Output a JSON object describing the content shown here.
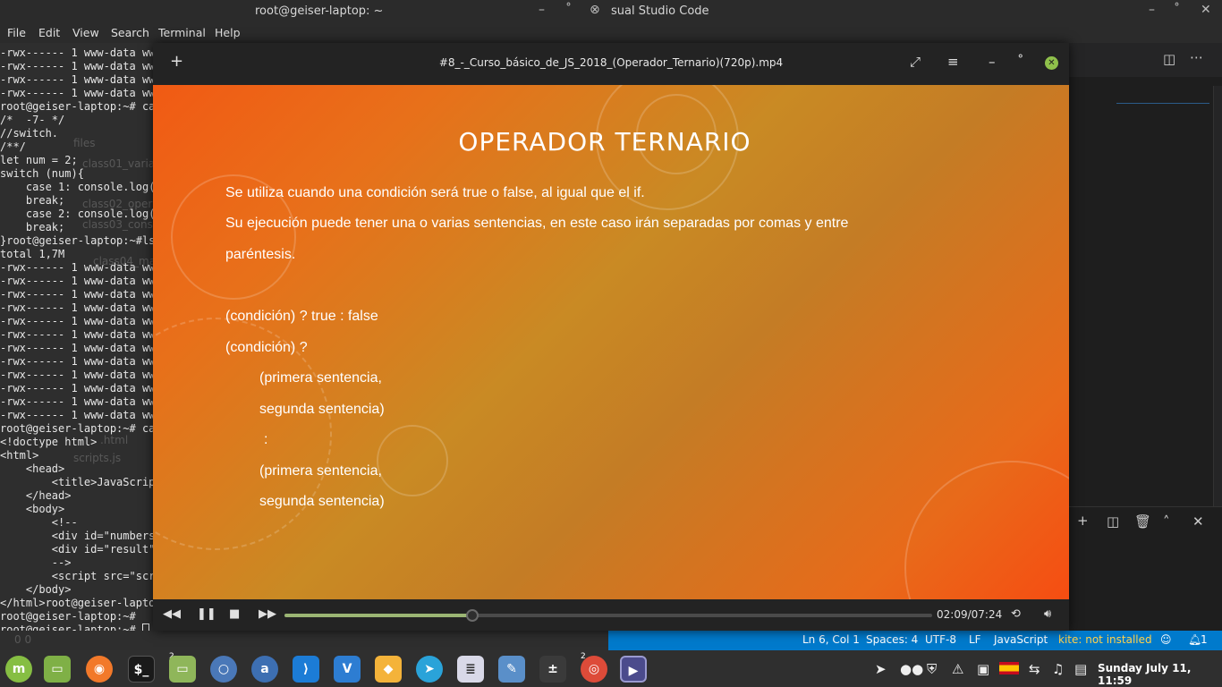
{
  "top_bar": {
    "terminal_title": "root@geiser-laptop: ~",
    "vscode_title": "sual Studio Code"
  },
  "terminal_menu": [
    "File",
    "Edit",
    "View",
    "Search",
    "Terminal",
    "Help"
  ],
  "terminal_lines": [
    "-rwx------ 1 www-data ww",
    "-rwx------ 1 www-data ww",
    "-rwx------ 1 www-data ww",
    "-rwx------ 1 www-data ww",
    "root@geiser-laptop:~# ca",
    "/*  -7- */",
    "//switch.",
    "/**/",
    "let num = 2;",
    "switch (num){",
    "    case 1: console.log(",
    "    break;",
    "    case 2: console.log(",
    "    break;",
    "}root@geiser-laptop:~#ls",
    "total 1,7M",
    "-rwx------ 1 www-data ww",
    "-rwx------ 1 www-data ww",
    "-rwx------ 1 www-data ww",
    "-rwx------ 1 www-data ww",
    "-rwx------ 1 www-data ww",
    "-rwx------ 1 www-data ww",
    "-rwx------ 1 www-data ww",
    "-rwx------ 1 www-data ww",
    "-rwx------ 1 www-data ww",
    "-rwx------ 1 www-data ww",
    "-rwx------ 1 www-data ww",
    "-rwx------ 1 www-data ww",
    "root@geiser-laptop:~# ca",
    "<!doctype html>",
    "<html>",
    "    <head>",
    "        <title>JavaScrip",
    "    </head>",
    "    <body>",
    "        <!--",
    "        <div id=\"numbers",
    "        <div id=\"result\"",
    "        -->",
    "        <script src=\"scr",
    "    </body>",
    "</html>root@geiser-lapto",
    "root@geiser-laptop:~#",
    "root@geiser-laptop:~# "
  ],
  "ghost_sidebar": {
    "files": "files",
    "class01": "class01_varia",
    "class02": "class02_oper",
    "class03": "class03_cons",
    "class04": "class04_math",
    "html": ".html",
    "scripts": "scripts.js",
    "counts": "0  0"
  },
  "player": {
    "title": "#8_-_Curso_básico_de_JS_2018_(Operador_Ternario)(720p).mp4",
    "time": "02:09/07:24",
    "progress": 0.29
  },
  "slide": {
    "title": "OPERADOR TERNARIO",
    "line1": "Se utiliza cuando una condición será true o false, al igual que el if.",
    "line2": "Su ejecución puede tener una o varias sentencias, en este caso irán separadas por comas y entre",
    "line3": "paréntesis.",
    "line4": "(condición) ? true : false",
    "line5": "(condición) ?",
    "line6": "(primera sentencia,",
    "line7": "segunda sentencia)",
    "line8": ":",
    "line9": "(primera sentencia,",
    "line10": "segunda sentencia)"
  },
  "statusbar": {
    "position": "Ln 6, Col 1",
    "spaces": "Spaces: 4",
    "encoding": "UTF-8",
    "eol": "LF",
    "language": "JavaScript",
    "kite": "kite: not installed",
    "notifications": "1"
  },
  "taskbar": {
    "badge_files": "2",
    "badge_chrome": "2",
    "clock": "Sunday July 11, 11:59"
  },
  "colors": {
    "statusbar": "#007acc",
    "kite": "#ffd24d",
    "progress": "#9bb574"
  }
}
